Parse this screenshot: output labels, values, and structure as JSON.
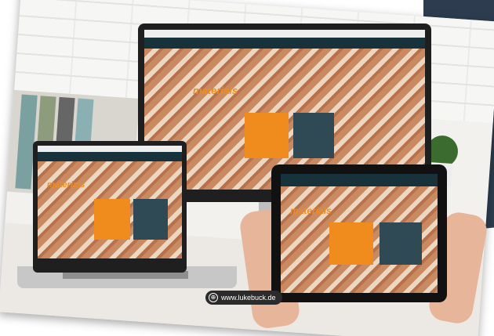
{
  "photo": {
    "url_badge": "www.lukebuck.de",
    "url_icon": "globe-icon"
  },
  "website": {
    "logo_orange": "materials",
    "tile_orange_label": "",
    "tile_dark_label": ""
  },
  "colors": {
    "orange": "#f08c1e",
    "teal_dark": "#2f4a55",
    "nav": "#17323a"
  }
}
